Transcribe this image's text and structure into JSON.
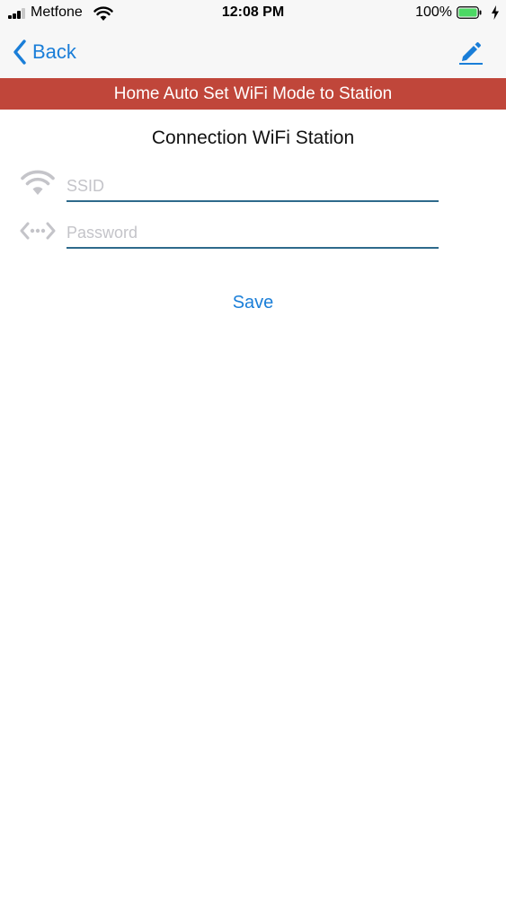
{
  "status_bar": {
    "carrier": "Metfone",
    "time": "12:08 PM",
    "battery_percent": "100%",
    "battery_level": 1.0,
    "signal_bars_filled": 3,
    "signal_bars_total": 4,
    "icons": [
      "signal-bars-icon",
      "wifi-icon",
      "battery-icon",
      "charging-bolt-icon"
    ]
  },
  "nav": {
    "back_label": "Back",
    "edit_icon": "pencil-icon"
  },
  "banner": {
    "title": "Home Auto Set WiFi Mode to Station"
  },
  "main": {
    "title": "Connection WiFi Station",
    "ssid": {
      "placeholder": "SSID",
      "value": "",
      "icon": "wifi-icon"
    },
    "password": {
      "placeholder": "Password",
      "value": "",
      "icon": "code-dots-icon"
    },
    "save_label": "Save"
  },
  "colors": {
    "accent": "#1a7ed8",
    "banner": "#c0463a",
    "field_underline": "#2e6a8c",
    "icon_gray": "#c4c4c9",
    "battery_green": "#4cd964"
  }
}
